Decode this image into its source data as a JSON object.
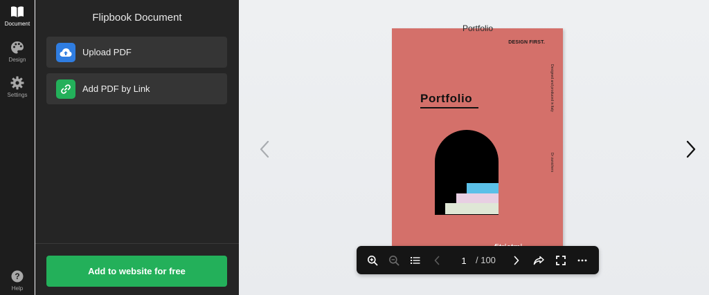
{
  "rail": {
    "items": [
      {
        "label": "Document",
        "icon": "book-open-icon",
        "active": true
      },
      {
        "label": "Design",
        "icon": "palette-icon",
        "active": false
      },
      {
        "label": "Settings",
        "icon": "gear-icon",
        "active": false
      }
    ],
    "help_label": "Help"
  },
  "panel": {
    "title": "Flipbook Document",
    "options": [
      {
        "label": "Upload PDF",
        "icon": "cloud-upload-icon",
        "color": "#2f7de1"
      },
      {
        "label": "Add PDF by Link",
        "icon": "link-icon",
        "color": "#23b05a"
      }
    ],
    "cta_label": "Add to website for free"
  },
  "viewer": {
    "book_title": "Portfolio",
    "cover": {
      "brand": "DESIGN FIRST.",
      "title": "Portfolio",
      "side_text_1": "Designed and produced in Italy",
      "side_text_2": "Dr zanichers",
      "bottom_text": "fitriatmi",
      "background": "#d4706a"
    },
    "toolbar": {
      "current_page": "1",
      "total_pages": "/ 100"
    }
  },
  "colors": {
    "rail_bg": "#1d1d1d",
    "panel_bg": "#252525",
    "option_bg": "#353535",
    "accent_green": "#23b05a",
    "accent_blue": "#2f7de1",
    "toolbar_bg": "#151515"
  }
}
